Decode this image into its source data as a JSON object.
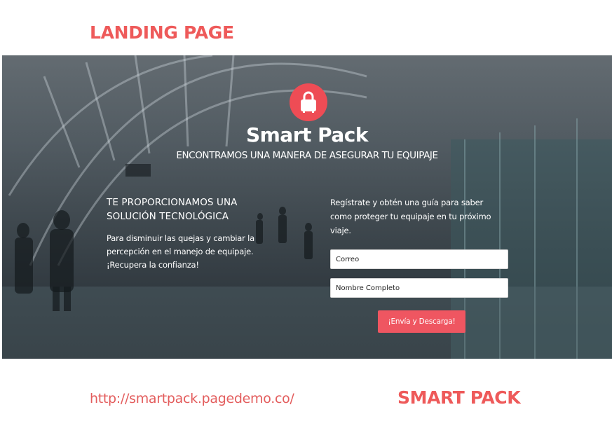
{
  "page_heading": "LANDING PAGE",
  "colors": {
    "accent": "#ee5a5a",
    "button": "#ef5661",
    "logo_circle": "#ee4c55",
    "overlay": "#30343a"
  },
  "hero": {
    "logo_icon": "suitcase-lock-icon",
    "brand": "Smart Pack",
    "tagline": "ENCONTRAMOS UNA MANERA DE ASEGURAR TU EQUIPAJE",
    "left": {
      "title": "TE PROPORCIONAMOS UNA SOLUCIÓN TECNOLÓGICA",
      "description": "Para disminuir las quejas y cambiar la percepción en el manejo de equipaje. ¡Recupera la confianza!"
    },
    "form": {
      "intro": "Regístrate y obtén una guía para saber como proteger tu equipaje en tu próximo viaje.",
      "email_placeholder": "Correo",
      "name_placeholder": "Nombre Completo",
      "submit_label": "¡Envía y Descarga!"
    }
  },
  "footer": {
    "url": "http://smartpack.pagedemo.co/",
    "brand": "SMART PACK"
  }
}
